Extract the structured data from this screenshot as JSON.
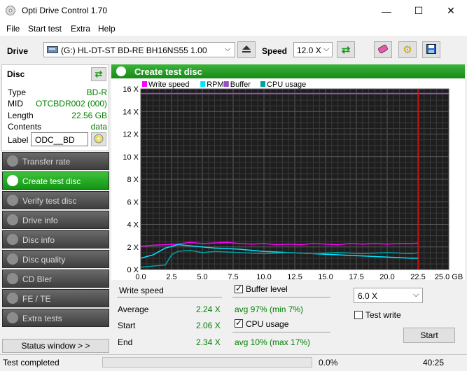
{
  "window": {
    "title": "Opti Drive Control 1.70",
    "minimize": "—",
    "maximize": "☐",
    "close": "✕"
  },
  "menu": [
    "File",
    "Start test",
    "Extra",
    "Help"
  ],
  "toolbar": {
    "drive_label": "Drive",
    "drive_value": "(G:)   HL-DT-ST BD-RE  BH16NS55 1.00",
    "speed_label": "Speed",
    "speed_value": "12.0 X"
  },
  "disc": {
    "header": "Disc",
    "rows": [
      {
        "k": "Type",
        "v": "BD-R"
      },
      {
        "k": "MID",
        "v": "OTCBDR002 (000)"
      },
      {
        "k": "Length",
        "v": "22.56 GB"
      },
      {
        "k": "Contents",
        "v": "data"
      }
    ],
    "label_key": "Label",
    "label_value": "ODC__BD"
  },
  "nav": [
    {
      "label": "Transfer rate",
      "active": false
    },
    {
      "label": "Create test disc",
      "active": true
    },
    {
      "label": "Verify test disc",
      "active": false
    },
    {
      "label": "Drive info",
      "active": false
    },
    {
      "label": "Disc info",
      "active": false
    },
    {
      "label": "Disc quality",
      "active": false
    },
    {
      "label": "CD Bler",
      "active": false
    },
    {
      "label": "FE / TE",
      "active": false
    },
    {
      "label": "Extra tests",
      "active": false
    }
  ],
  "status_window": "Status window > >",
  "main": {
    "title": "Create test disc"
  },
  "chart_data": {
    "type": "line",
    "legend": [
      {
        "name": "Write speed",
        "color": "#ff00ff"
      },
      {
        "name": "RPM",
        "color": "#00e5ff"
      },
      {
        "name": "Buffer",
        "color": "#9b4dca"
      },
      {
        "name": "CPU usage",
        "color": "#00a0a0"
      }
    ],
    "y_ticks": [
      "0 X",
      "2 X",
      "4 X",
      "6 X",
      "8 X",
      "10 X",
      "12 X",
      "14 X",
      "16 X"
    ],
    "x_ticks": [
      "0.0",
      "2.5",
      "5.0",
      "7.5",
      "10.0",
      "12.5",
      "15.0",
      "17.5",
      "20.0",
      "22.5",
      "25.0 GB"
    ],
    "xlim": [
      0,
      25
    ],
    "ylim": [
      0,
      16
    ],
    "end_marker_x": 22.56,
    "series": [
      {
        "name": "Write speed",
        "x": [
          0,
          0.5,
          1,
          2,
          3,
          4,
          5,
          6,
          7,
          8,
          9,
          10,
          11,
          12,
          13,
          14,
          15,
          16,
          17,
          18,
          19,
          20,
          21,
          22,
          22.56
        ],
        "y": [
          2.06,
          2.1,
          2.15,
          2.2,
          2.25,
          2.4,
          2.3,
          2.35,
          2.4,
          2.3,
          2.25,
          2.3,
          2.2,
          2.25,
          2.2,
          2.3,
          2.25,
          2.2,
          2.3,
          2.25,
          2.3,
          2.25,
          2.3,
          2.3,
          2.34
        ]
      },
      {
        "name": "RPM",
        "x": [
          0,
          1,
          2,
          3,
          4,
          5,
          6,
          7,
          8,
          9,
          10,
          11,
          12,
          13,
          14,
          15,
          16,
          17,
          18,
          19,
          20,
          21,
          22,
          22.56
        ],
        "y": [
          1.0,
          1.3,
          1.9,
          2.2,
          2.1,
          2.0,
          1.9,
          1.85,
          1.8,
          1.7,
          1.6,
          1.55,
          1.5,
          1.45,
          1.4,
          1.35,
          1.3,
          1.25,
          1.2,
          1.15,
          1.1,
          1.05,
          1.0,
          1.0
        ]
      },
      {
        "name": "Buffer",
        "x": [
          0,
          25
        ],
        "y": [
          15.6,
          15.6
        ]
      },
      {
        "name": "CPU usage",
        "x": [
          0,
          1,
          2,
          2.5,
          3,
          4,
          5,
          6,
          8,
          10,
          12,
          14,
          16,
          18,
          20,
          22,
          22.56
        ],
        "y": [
          0.2,
          0.3,
          0.4,
          1.3,
          1.6,
          1.7,
          1.5,
          1.6,
          1.5,
          1.4,
          1.5,
          1.4,
          1.5,
          1.4,
          1.5,
          1.4,
          1.5
        ]
      }
    ]
  },
  "stats": {
    "write_speed_label": "Write speed",
    "rows": [
      {
        "k": "Average",
        "v": "2.24 X"
      },
      {
        "k": "Start",
        "v": "2.06 X"
      },
      {
        "k": "End",
        "v": "2.34 X"
      }
    ],
    "buffer_label": "Buffer level",
    "buffer_avg": "avg 97% (min 7%)",
    "cpu_label": "CPU usage",
    "cpu_avg": "avg 10% (max 17%)",
    "speed_select": "6.0 X",
    "test_write_label": "Test write",
    "start_button": "Start"
  },
  "status": {
    "text": "Test completed",
    "progress": "0.0%",
    "time": "40:25"
  }
}
